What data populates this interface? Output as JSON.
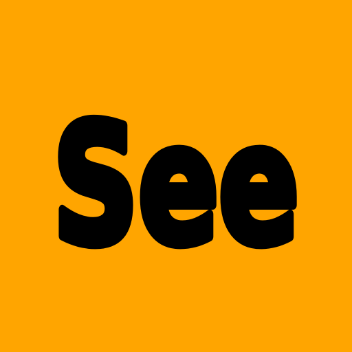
{
  "card": {
    "word": "See",
    "background_color": "#FFA500",
    "text_color": "#000000"
  }
}
